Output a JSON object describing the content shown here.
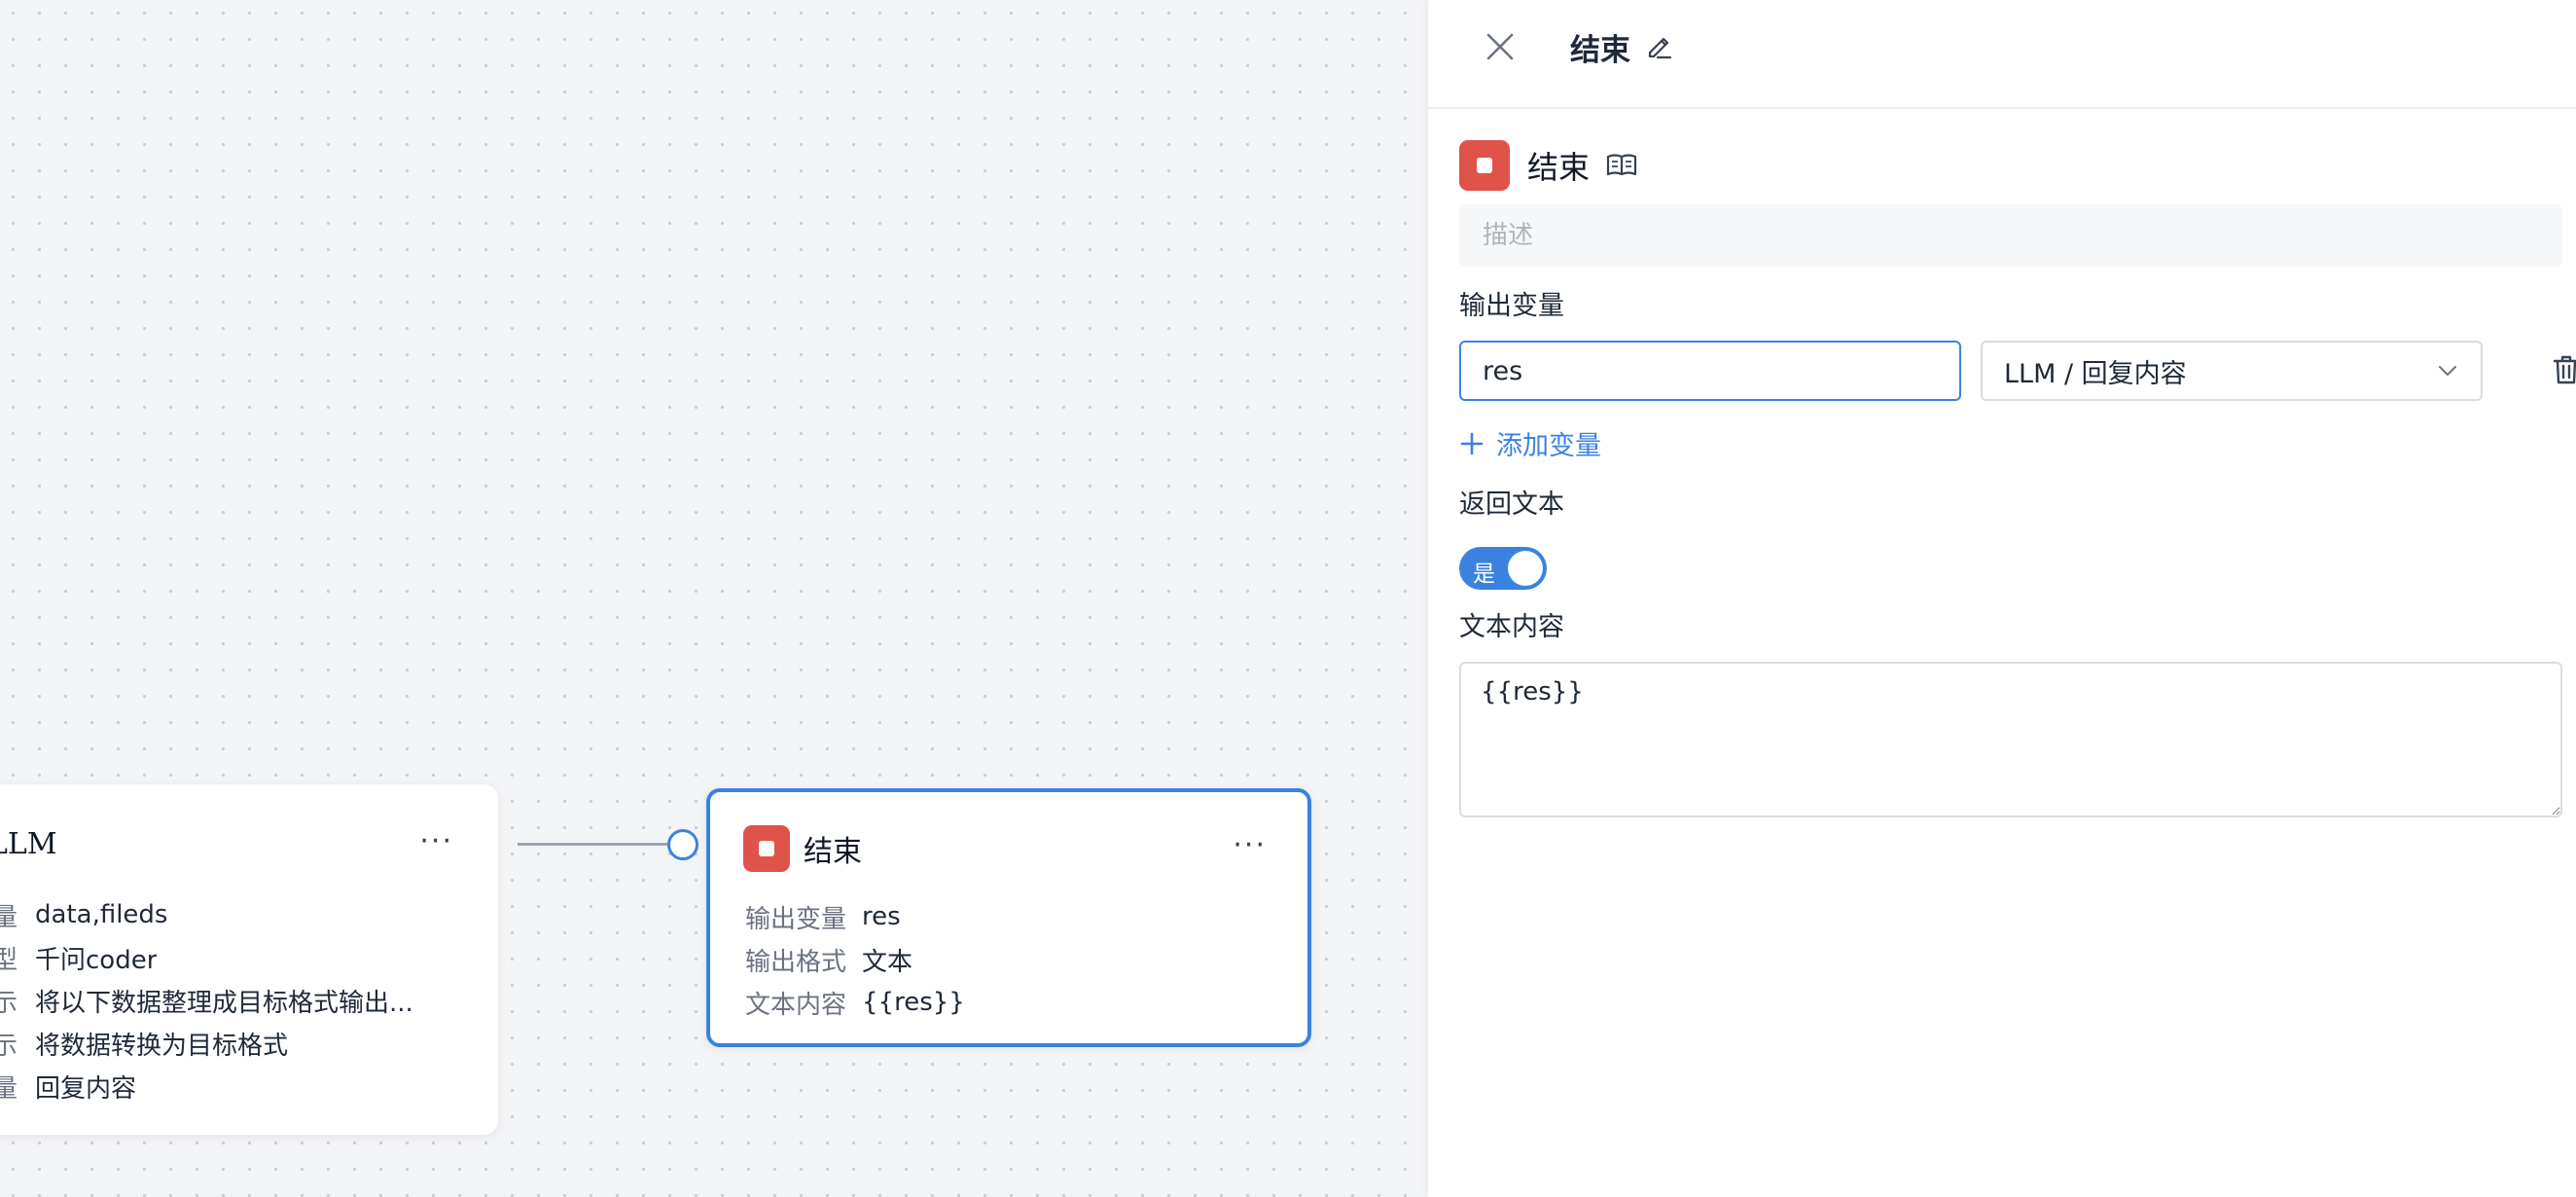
{
  "canvas": {
    "llm_node": {
      "title": "LLM",
      "more_label": "···",
      "rows": [
        {
          "key": "变量",
          "value": "data,fileds"
        },
        {
          "key": "模型",
          "value": "千问coder"
        },
        {
          "key": "提示",
          "value": "将以下数据整理成目标格式输出..."
        },
        {
          "key": "提示",
          "value": "将数据转换为目标格式"
        },
        {
          "key": "变量",
          "value": "回复内容"
        }
      ]
    },
    "end_node": {
      "title": "结束",
      "more_label": "···",
      "rows": [
        {
          "key": "输出变量",
          "value": "res"
        },
        {
          "key": "输出格式",
          "value": "文本"
        },
        {
          "key": "文本内容",
          "value": "{{res}}"
        }
      ]
    }
  },
  "panel": {
    "title": "结束",
    "node_name": "结束",
    "description_placeholder": "描述",
    "output_vars_label": "输出变量",
    "output_vars": [
      {
        "name": "res",
        "source": "LLM / 回复内容"
      }
    ],
    "add_var_label": "添加变量",
    "return_text_label": "返回文本",
    "return_text_toggle": {
      "label": "是",
      "on": true
    },
    "text_content_label": "文本内容",
    "text_content_value": "{{res}}"
  },
  "colors": {
    "accent": "#3b82e0",
    "end_icon": "#e0534b"
  }
}
